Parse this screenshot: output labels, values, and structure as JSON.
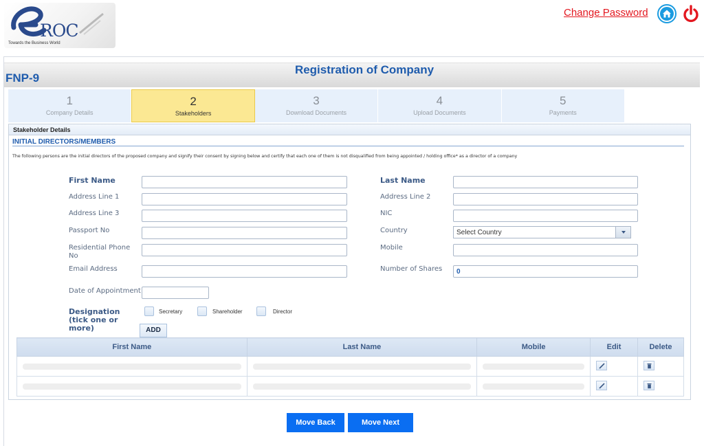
{
  "header": {
    "logo_text": "ROC",
    "logo_tagline": "Towards the Business World",
    "change_password": "Change Password",
    "icons": {
      "home": "home-icon",
      "power": "power-icon"
    },
    "colors": {
      "link": "#e3171f",
      "home": "#1a9be0",
      "power": "#e3171f"
    }
  },
  "titlebar": {
    "form_code": "FNP-9",
    "title": "Registration of Company"
  },
  "steps": [
    {
      "num": "1",
      "label": "Company Details",
      "active": false
    },
    {
      "num": "2",
      "label": "Stakeholders",
      "active": true
    },
    {
      "num": "3",
      "label": "Download Documents",
      "active": false
    },
    {
      "num": "4",
      "label": "Upload Documents",
      "active": false
    },
    {
      "num": "5",
      "label": "Payments",
      "active": false
    }
  ],
  "panel": {
    "head": "Stakeholder Details",
    "section_title": "INITIAL DIRECTORS/MEMBERS",
    "intro": "The following persons are the initial directors of the proposed company and signify their consent by signing below and certify that each one of them is not disqualified from being appointed / holding office* as a director of a company"
  },
  "form": {
    "first_name": {
      "label": "First Name",
      "value": ""
    },
    "last_name": {
      "label": "Last Name",
      "value": ""
    },
    "address1": {
      "label": "Address Line 1",
      "value": ""
    },
    "address2": {
      "label": "Address Line 2",
      "value": ""
    },
    "address3": {
      "label": "Address Line 3",
      "value": ""
    },
    "nic": {
      "label": "NIC",
      "value": ""
    },
    "passport": {
      "label": "Passport No",
      "value": ""
    },
    "country": {
      "label": "Country",
      "value": "Select Country"
    },
    "res_phone": {
      "label": "Residential Phone No",
      "value": ""
    },
    "mobile": {
      "label": "Mobile",
      "value": ""
    },
    "email": {
      "label": "Email Address",
      "value": ""
    },
    "shares": {
      "label": "Number of Shares",
      "value": "0"
    },
    "appointment": {
      "label": "Date of Appointment",
      "value": ""
    },
    "designation": {
      "label": "Designation (tick one or more)",
      "options": [
        "Secretary",
        "Shareholder",
        "Director"
      ]
    },
    "add_label": "ADD"
  },
  "table": {
    "headers": [
      "First Name",
      "Last Name",
      "Mobile",
      "Edit",
      "Delete"
    ],
    "rows": [
      {
        "first_name": "",
        "last_name": "",
        "mobile": ""
      },
      {
        "first_name": "",
        "last_name": "",
        "mobile": ""
      }
    ]
  },
  "footer": {
    "back_label": "Move Back",
    "next_label": "Move Next"
  }
}
